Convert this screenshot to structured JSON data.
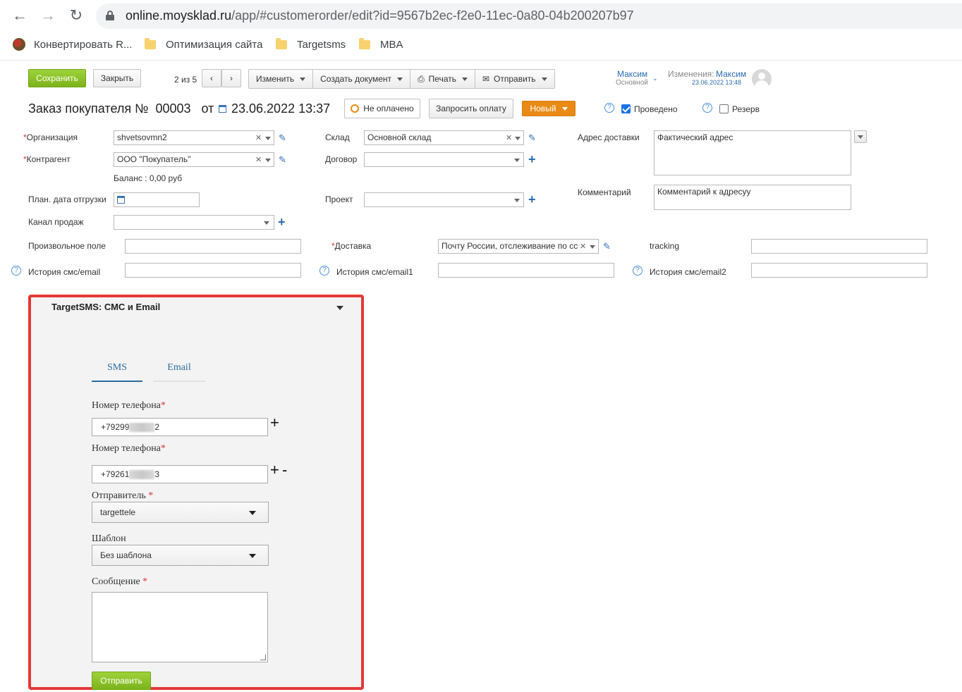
{
  "browser": {
    "url_host": "online.moysklad.ru",
    "url_path": "/app/#customerorder/edit?id=9567b2ec-f2e0-11ec-0a80-04b200207b97",
    "bookmarks": [
      "Конвертировать R...",
      "Оптимизация сайта",
      "Targetsms",
      "MBA"
    ]
  },
  "toolbar": {
    "save": "Сохранить",
    "close": "Закрыть",
    "pager": "2 из 5",
    "change": "Изменить",
    "create_doc": "Создать документ",
    "print": "Печать",
    "send": "Отправить",
    "owner_name": "Максим",
    "owner_role": "Основной",
    "changes_label": "Изменения:",
    "changes_user": "Максим",
    "changes_date": "23.06.2022 13:48"
  },
  "order": {
    "title_prefix": "Заказ покупателя №",
    "number": "00003",
    "from": "от",
    "date": "23.06.2022 13:37",
    "payment_status": "Не оплачено",
    "request_payment": "Запросить оплату",
    "state": "Новый",
    "posted_label": "Проведено",
    "posted": true,
    "reserve_label": "Резерв",
    "reserve": false
  },
  "form": {
    "organization_label": "Организация",
    "organization": "shvetsovmn2",
    "counterparty_label": "Контрагент",
    "counterparty": "ООО \"Покупатель\"",
    "balance": "Баланс : 0,00 руб",
    "ship_date_label": "План. дата отгрузки",
    "sales_channel_label": "Канал продаж",
    "warehouse_label": "Склад",
    "warehouse": "Основной склад",
    "contract_label": "Договор",
    "project_label": "Проект",
    "delivery_address_label": "Адрес доставки",
    "delivery_address": "Фактический адрес",
    "comment_label": "Комментарий",
    "comment": "Комментарий к адресуу",
    "custom_field_label": "Произвольное поле",
    "delivery_label": "Доставка",
    "delivery": "Почту России, отслеживание по сс",
    "tracking_label": "tracking",
    "history1_label": "История смс/email",
    "history2_label": "История смс/email1",
    "history3_label": "История смс/email2"
  },
  "widget": {
    "title": "TargetSMS: СМС и Email",
    "tab_sms": "SMS",
    "tab_email": "Email",
    "phone_label": "Номер телефона",
    "phone1": "+79299",
    "phone1_tail": "2",
    "phone2": "+79261",
    "phone2_tail": "3",
    "sender_label": "Отправитель",
    "sender": "targettele",
    "template_label": "Шаблон",
    "template": "Без шаблона",
    "message_label": "Сообщение",
    "send_button": "Отправить"
  },
  "colors": {
    "accent_green": "#8bc34a",
    "state_orange": "#e98a16",
    "highlight_red": "#e53935",
    "link_blue": "#2b6cb0"
  }
}
